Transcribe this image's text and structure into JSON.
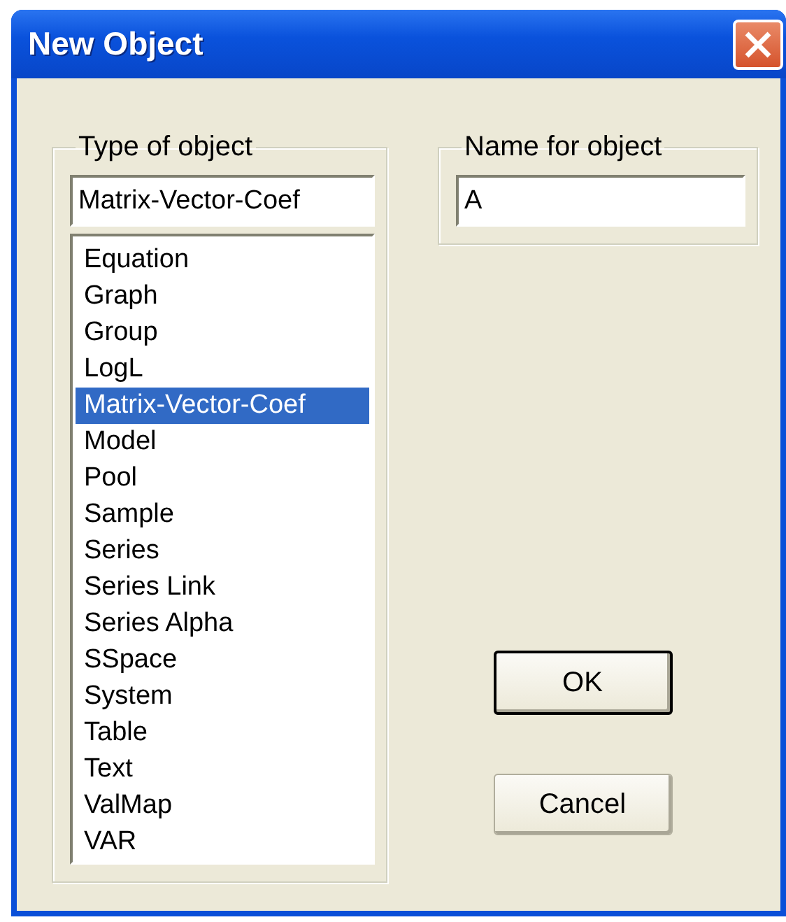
{
  "window": {
    "title": "New Object"
  },
  "type_group": {
    "label": "Type of object",
    "value": "Matrix-Vector-Coef",
    "items": [
      {
        "label": "Equation",
        "selected": false
      },
      {
        "label": "Graph",
        "selected": false
      },
      {
        "label": "Group",
        "selected": false
      },
      {
        "label": "LogL",
        "selected": false
      },
      {
        "label": "Matrix-Vector-Coef",
        "selected": true
      },
      {
        "label": "Model",
        "selected": false
      },
      {
        "label": "Pool",
        "selected": false
      },
      {
        "label": "Sample",
        "selected": false
      },
      {
        "label": "Series",
        "selected": false
      },
      {
        "label": "Series Link",
        "selected": false
      },
      {
        "label": "Series Alpha",
        "selected": false
      },
      {
        "label": "SSpace",
        "selected": false
      },
      {
        "label": "System",
        "selected": false
      },
      {
        "label": "Table",
        "selected": false
      },
      {
        "label": "Text",
        "selected": false
      },
      {
        "label": "ValMap",
        "selected": false
      },
      {
        "label": "VAR",
        "selected": false
      }
    ]
  },
  "name_group": {
    "label": "Name for object",
    "value": "A"
  },
  "buttons": [
    {
      "label": "OK",
      "default": true
    },
    {
      "label": "Cancel",
      "default": false
    }
  ]
}
